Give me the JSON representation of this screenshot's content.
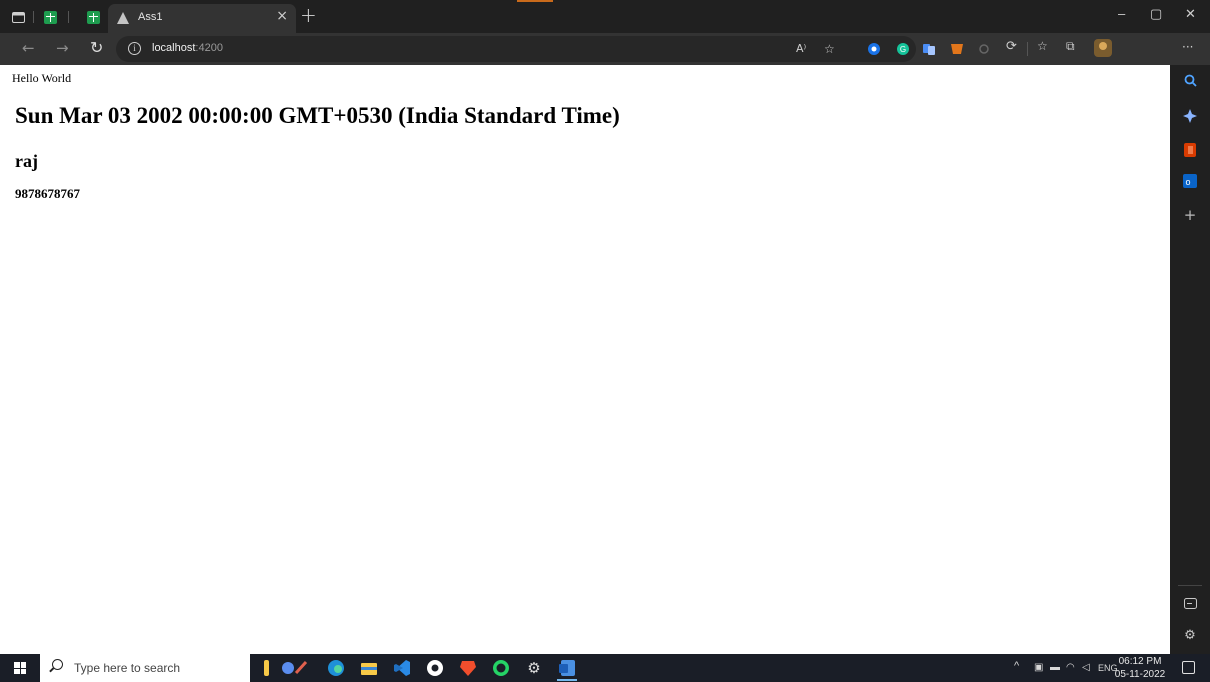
{
  "browser": {
    "active_tab": {
      "title": "Ass1",
      "close_glyph": "×"
    },
    "new_tab_glyph": "+",
    "window_controls": {
      "minimize": "–",
      "restore": "▢",
      "close": "✕"
    },
    "address": {
      "host": "localhost",
      "port": ":4200"
    },
    "nav": {
      "back": "←",
      "forward": "→",
      "refresh": "↻"
    },
    "toolbar": {
      "read_aloud": "A⁾",
      "more": "···"
    }
  },
  "page": {
    "hello": "Hello World",
    "date": "Sun Mar 03 2002 00:00:00 GMT+0530 (India Standard Time)",
    "name": "raj",
    "phone": "9878678767"
  },
  "sidebar": {
    "add_glyph": "+"
  },
  "taskbar": {
    "search_placeholder": "Type here to search",
    "tray": {
      "language": "ENG",
      "chevron": "^"
    },
    "clock": {
      "time": "06:12 PM",
      "date": "05-11-2022"
    }
  },
  "colors": {
    "chrome_dark": "#202020",
    "toolbar": "#333333",
    "page_bg": "#ffffff",
    "taskbar": "#1a1e27",
    "sheets_green": "#1e9c4f"
  }
}
